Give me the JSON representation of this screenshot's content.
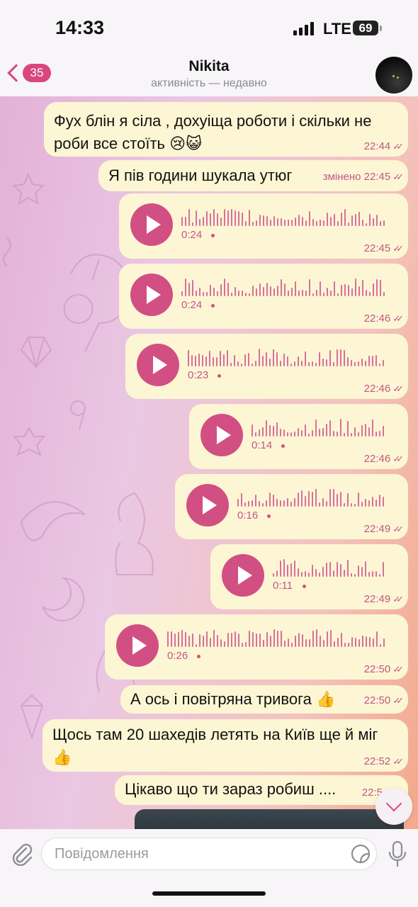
{
  "status_bar": {
    "time": "14:33",
    "network": "LTE",
    "battery": "69"
  },
  "header": {
    "back_badge": "35",
    "title": "Nikita",
    "subtitle": "активність — недавно"
  },
  "colors": {
    "accent": "#d9477e",
    "bubble": "#fdf6d4",
    "meta_text": "#c0578a"
  },
  "messages": [
    {
      "type": "text",
      "text_line1": "Фух блін я сіла , дохуіща роботи і скільки не",
      "text_line2": "роби все стоїть 😢😺",
      "time": "22:44"
    },
    {
      "type": "text",
      "text": "Я пів години шукала утюг",
      "edited": "змінено",
      "time": "22:45"
    },
    {
      "type": "voice",
      "duration": "0:24",
      "time": "22:45"
    },
    {
      "type": "voice",
      "duration": "0:24",
      "time": "22:46"
    },
    {
      "type": "voice",
      "duration": "0:23",
      "time": "22:46"
    },
    {
      "type": "voice",
      "duration": "0:14",
      "time": "22:46"
    },
    {
      "type": "voice",
      "duration": "0:16",
      "time": "22:49"
    },
    {
      "type": "voice",
      "duration": "0:11",
      "time": "22:49"
    },
    {
      "type": "voice",
      "duration": "0:26",
      "time": "22:50"
    },
    {
      "type": "text",
      "text": "А ось і повітряна тривога 👍",
      "time": "22:50"
    },
    {
      "type": "text",
      "text_line1": "Щось там 20 шахедів летять на Київ ще й міг",
      "text_line2": "👍",
      "time": "22:52"
    },
    {
      "type": "text",
      "text": "Цікаво що ти зараз робиш ....",
      "time": "22:5"
    }
  ],
  "input": {
    "placeholder": "Повідомлення"
  },
  "icons": {
    "back": "chevron-left-icon",
    "attach": "paperclip-icon",
    "sticker": "sticker-icon",
    "mic": "microphone-icon",
    "scroll_down": "chevron-down-icon",
    "read_receipt": "double-check-icon"
  }
}
